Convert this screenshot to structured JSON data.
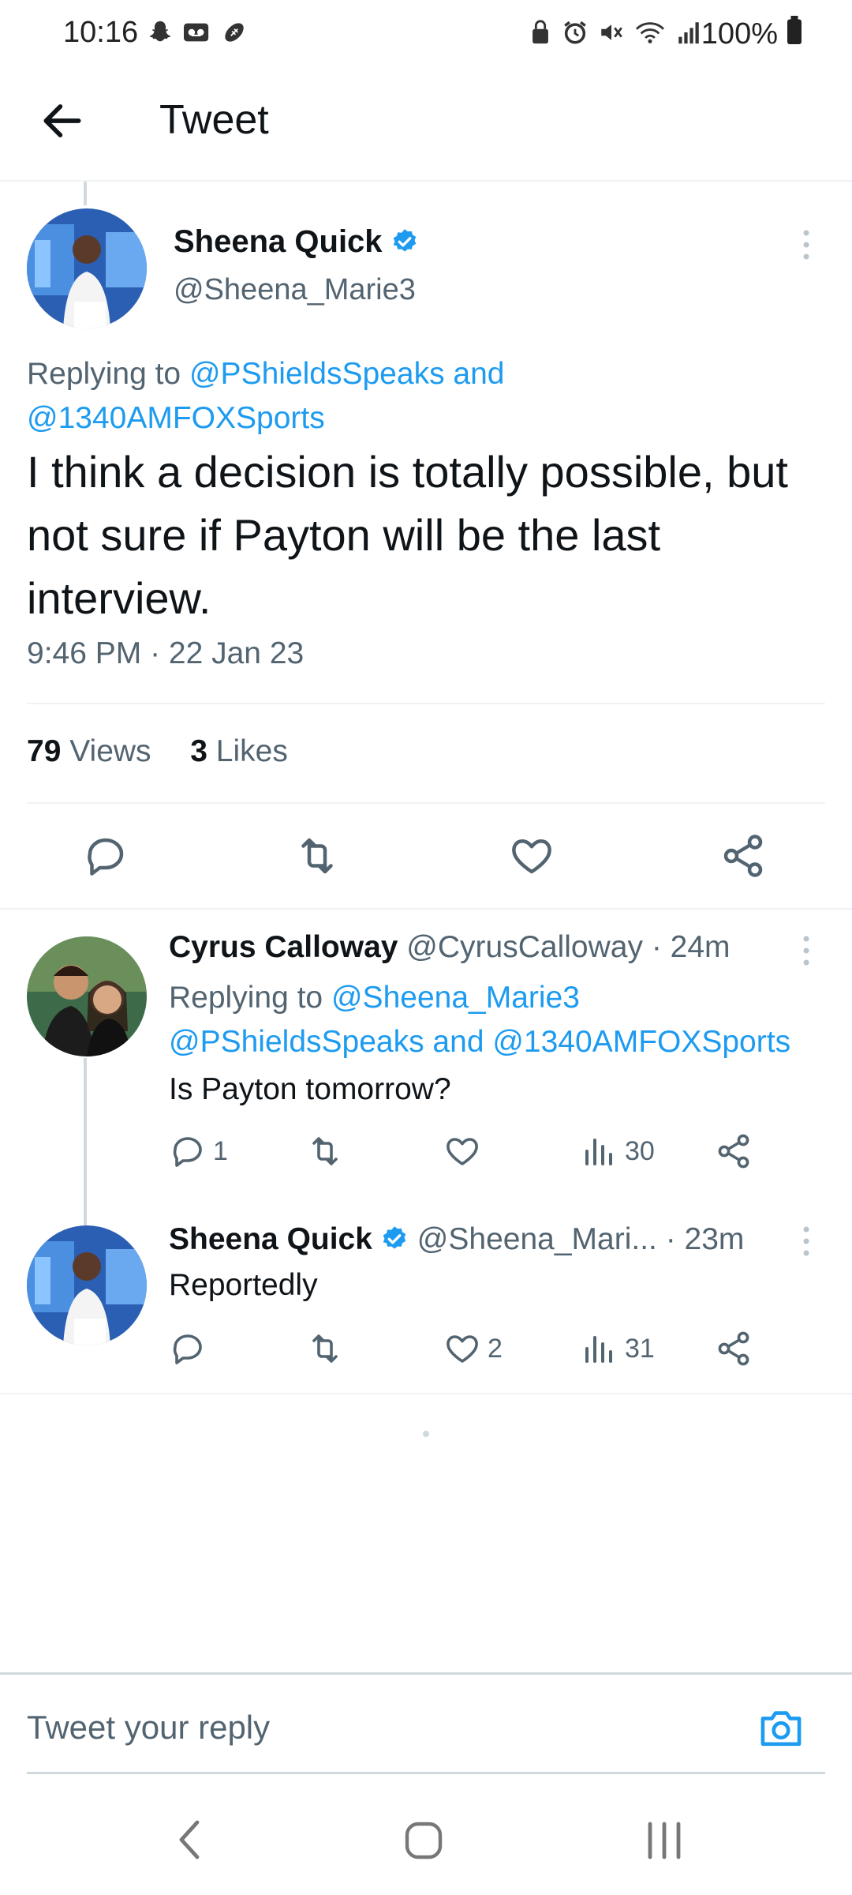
{
  "status_bar": {
    "time": "10:16",
    "battery": "100%"
  },
  "header": {
    "title": "Tweet"
  },
  "main_tweet": {
    "author_name": "Sheena Quick",
    "author_handle": "@Sheena_Marie3",
    "replying_prefix": "Replying to",
    "replying_mentions_1": "@PShieldsSpeaks and",
    "replying_mentions_2": "@1340AMFOXSports",
    "text": "I think a decision is totally possible, but not sure if Payton will be the last interview.",
    "timestamp": "9:46 PM · 22 Jan 23",
    "views_count": "79",
    "views_label": "Views",
    "likes_count": "3",
    "likes_label": "Likes"
  },
  "replies": [
    {
      "author_name": "Cyrus Calloway",
      "author_handle": "@CyrusCalloway",
      "time": "· 24m",
      "replying_prefix": "Replying to",
      "replying_line1": "@Sheena_Marie3",
      "replying_line2": "@PShieldsSpeaks and @1340AMFOXSports",
      "text": "Is Payton tomorrow?",
      "reply_count": "1",
      "like_count": "",
      "view_count": "30"
    },
    {
      "author_name": "Sheena Quick",
      "author_handle": "@Sheena_Mari...",
      "time": "· 23m",
      "text": "Reportedly",
      "reply_count": "",
      "like_count": "2",
      "view_count": "31"
    }
  ],
  "composer": {
    "placeholder": "Tweet your reply"
  },
  "colors": {
    "accent": "#1d9bf0",
    "text": "#0f1419",
    "muted": "#536471",
    "divider": "#eff3f4"
  },
  "icons": {
    "back": "arrow-left-icon",
    "verified": "verified-badge-icon",
    "more": "kebab-icon",
    "reply": "reply-icon",
    "retweet": "retweet-icon",
    "like": "heart-icon",
    "views": "views-icon",
    "share": "share-icon",
    "camera": "camera-icon"
  }
}
